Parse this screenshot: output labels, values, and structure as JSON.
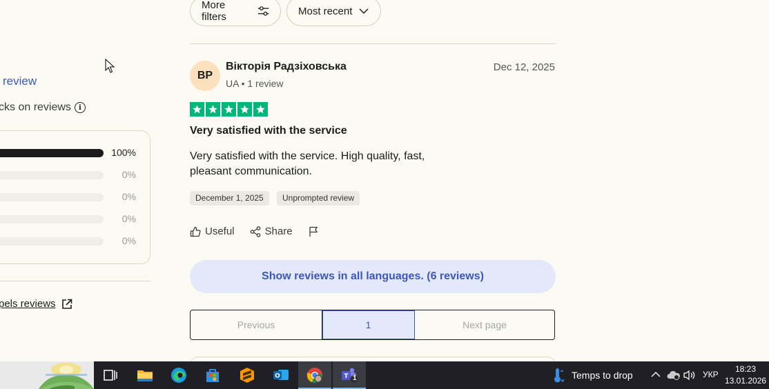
{
  "left": {
    "write_review": "review",
    "checks_note": "cks on reviews",
    "distribution": [
      "100%",
      "0%",
      "0%",
      "0%",
      "0%"
    ],
    "distribution_fill": [
      1.0,
      0,
      0,
      0,
      0
    ],
    "external_link": "pels reviews"
  },
  "filters": {
    "more_filters": "More filters",
    "sort": "Most recent"
  },
  "review": {
    "initials": "BP",
    "name": "Вікторія Радзіховська",
    "country": "UA",
    "review_count": "1 review",
    "posted_date": "Dec 12, 2025",
    "rating": 5,
    "title": "Very satisfied with the service",
    "body": "Very satisfied with the service. High quality, fast, pleasant communication.",
    "experience_date": "December 1, 2025",
    "tag": "Unprompted review",
    "useful": "Useful",
    "share": "Share"
  },
  "show_all": "Show reviews in all languages. (6 reviews)",
  "pagination": {
    "previous": "Previous",
    "current": "1",
    "next": "Next page"
  },
  "taskbar": {
    "weather": "Temps to drop",
    "language": "УКР",
    "time": "18:23",
    "date": "13.01.2026",
    "teams_badge": "1"
  },
  "colors": {
    "background": "#fcfbf3",
    "trustpilot_green": "#00b67a",
    "link_blue": "#3c57bc",
    "highlight": "#e4e8fb"
  }
}
